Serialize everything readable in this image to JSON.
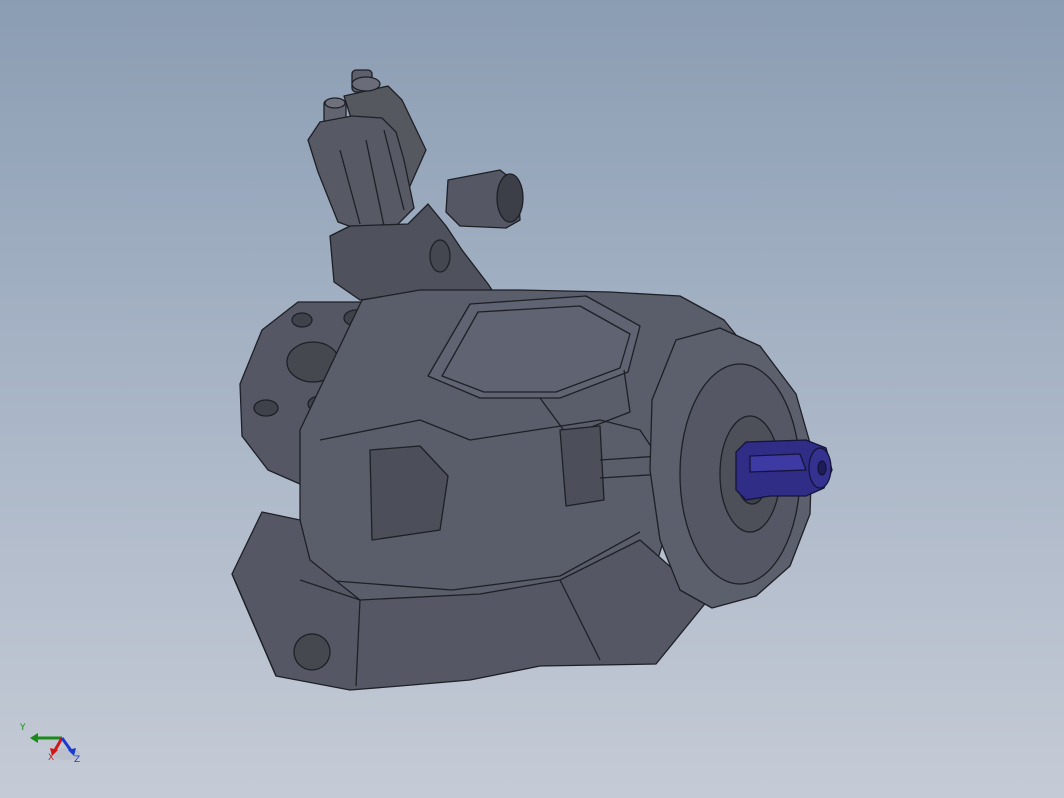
{
  "viewport": {
    "background_top": "#8b9db3",
    "background_bottom": "#c5cbd6",
    "model_color": "#5a5d6a",
    "model_edge_color": "#1e2026",
    "shaft_color": "#2f2d86"
  },
  "model": {
    "name_icon": "hydraulic-pump-model"
  },
  "triad": {
    "y_label": "Y",
    "x_label": "X",
    "z_label": "Z",
    "y_color": "#1a8a1a",
    "x_color": "#d01818",
    "z_color": "#1a3ad0"
  }
}
